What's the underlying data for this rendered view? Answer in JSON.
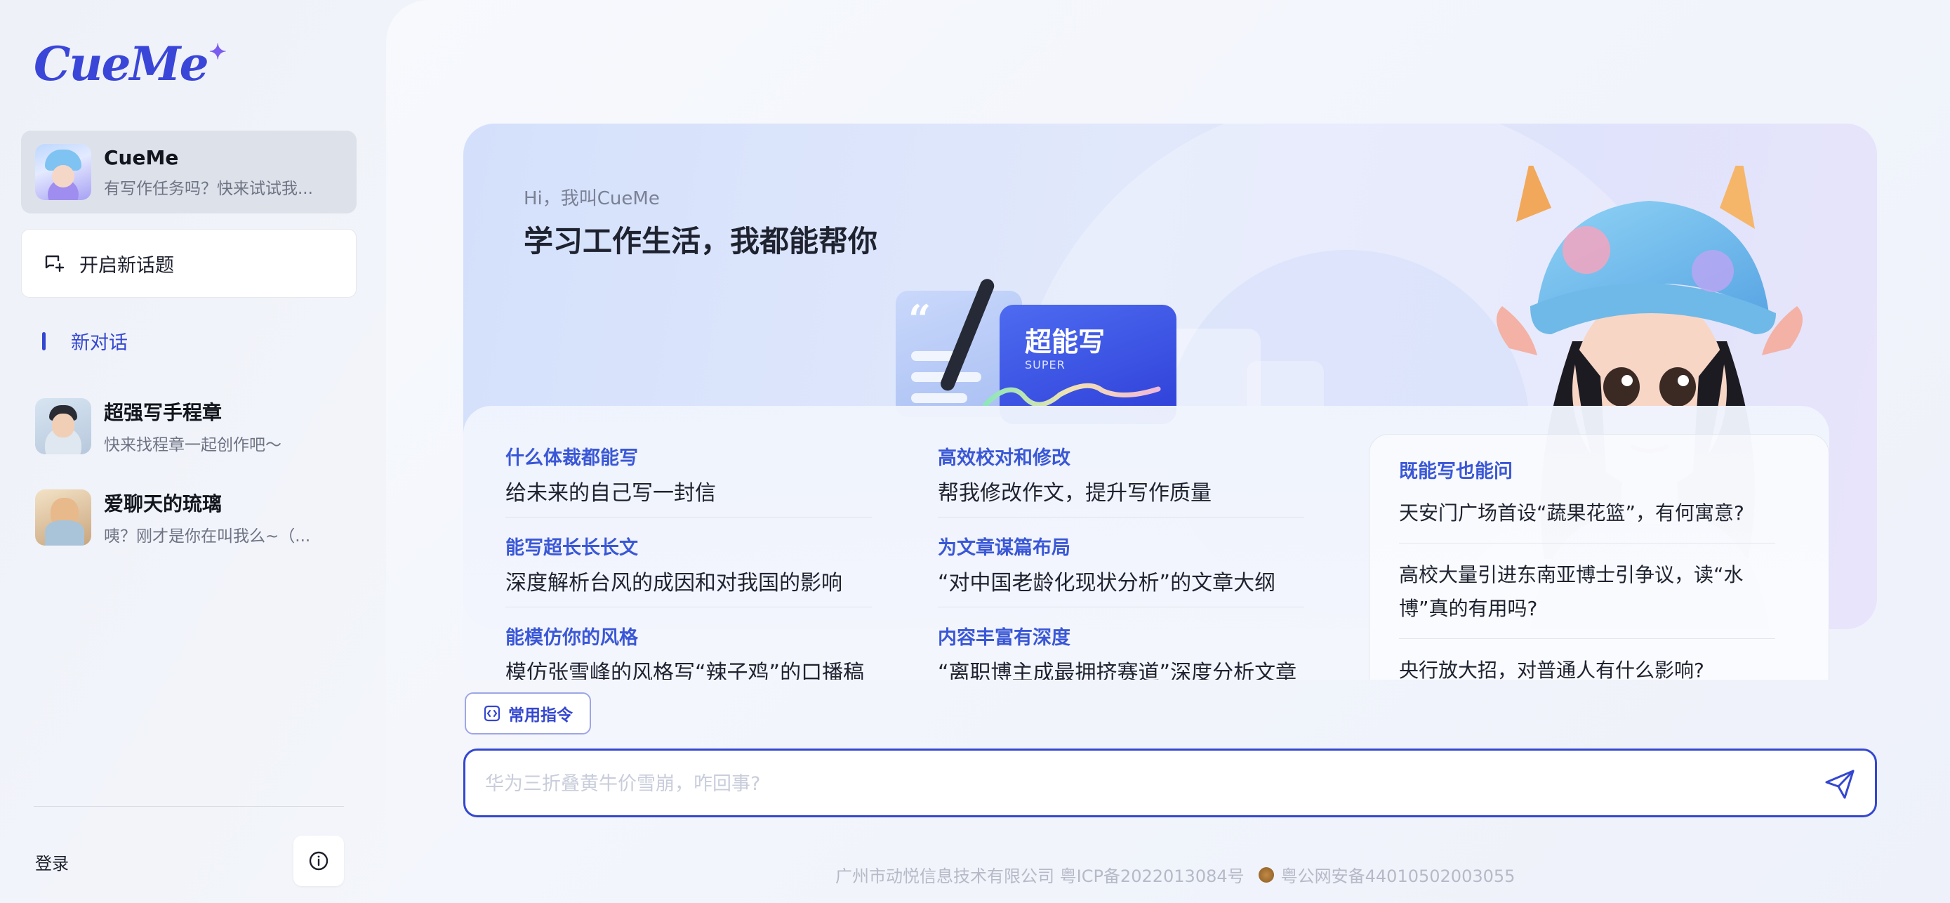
{
  "app": {
    "name": "CueMe"
  },
  "sidebar": {
    "logo": "CueMe",
    "active_chat": {
      "title": "CueMe",
      "subtitle": "有写作任务吗？快来试试我..."
    },
    "new_topic_label": "开启新话题",
    "new_chat_label": "新对话",
    "chats": [
      {
        "title": "超强写手程章",
        "subtitle": "快来找程章一起创作吧～"
      },
      {
        "title": "爱聊天的琉璃",
        "subtitle": "咦？刚才是你在叫我么~（..."
      }
    ],
    "login_label": "登录",
    "icons": {
      "new_topic": "new-chat-icon",
      "info": "info-icon"
    }
  },
  "hero": {
    "greeting": "Hi，我叫CueMe",
    "headline": "学习工作生活，我都能帮你",
    "badge_title": "超能写",
    "badge_sub": "SUPER"
  },
  "suggestions": [
    {
      "head": "什么体裁都能写",
      "body": "给未来的自己写一封信"
    },
    {
      "head": "高效校对和修改",
      "body": "帮我修改作文，提升写作质量"
    },
    {
      "head": "能写超长长长文",
      "body": "深度解析台风的成因和对我国的影响"
    },
    {
      "head": "为文章谋篇布局",
      "body": "“对中国老龄化现状分析”的文章大纲"
    },
    {
      "head": "能模仿你的风格",
      "body": "模仿张雪峰的风格写“辣子鸡”的口播稿"
    },
    {
      "head": "内容丰富有深度",
      "body": "“离职博主成最拥挤赛道”深度分析文章"
    }
  ],
  "ask": {
    "title": "既能写也能问",
    "questions": [
      "天安门广场首设“蔬果花篮”，有何寓意?",
      "高校大量引进东南亚博士引争议，读“水博”真的有用吗?",
      "央行放大招，对普通人有什么影响?"
    ]
  },
  "composer": {
    "commands_label": "常用指令",
    "placeholder": "华为三折叠黄牛价雪崩，咋回事?",
    "value": ""
  },
  "footer": {
    "company": "广州市动悦信息技术有限公司 粤ICP备2022013084号",
    "police": "粤公网安备44010502003055"
  },
  "colors": {
    "accent": "#3447d0",
    "link": "#3a57d6"
  }
}
